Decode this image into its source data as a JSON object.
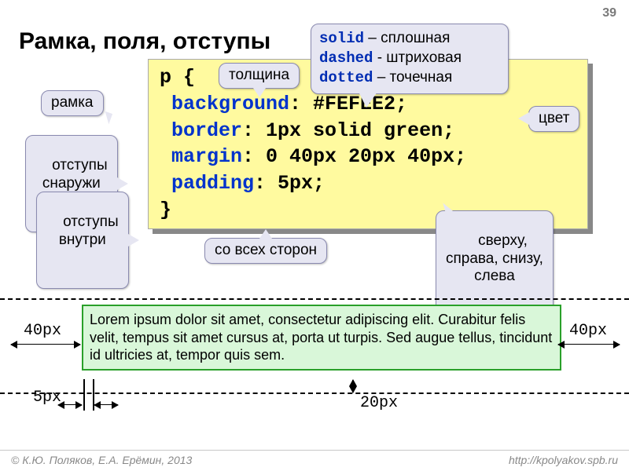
{
  "slide_number": "39",
  "title": "Рамка, поля, отступы",
  "code": {
    "line1a": "p {",
    "line2a": " background",
    "line2b": ": #FEFEE2;",
    "line3a": " border",
    "line3b": ": 1px solid green;",
    "line4a": " margin",
    "line4b": ": 0 40px 20px 40px;",
    "line5a": " padding",
    "line5b": ": 5px;",
    "line6": "}"
  },
  "callouts": {
    "ramka": "рамка",
    "outside": "отступы\nснаружи",
    "inside": "отступы\nвнутри",
    "thickness": "толщина",
    "color": "цвет",
    "allsides": "со всех сторон",
    "sides4": "сверху,\nсправа, снизу,\nслева"
  },
  "legend": {
    "solid_kw": "solid",
    "solid_txt": " – сплошная",
    "dashed_kw": "dashed",
    "dashed_txt": " - штриховая",
    "dotted_kw": "dotted",
    "dotted_txt": " – точечная"
  },
  "lorem": "Lorem ipsum dolor sit amet, consectetur adipiscing elit. Curabitur felis velit, tempus sit amet cursus at, porta ut turpis. Sed augue tellus, tincidunt id ultricies at, tempor quis sem.",
  "dims": {
    "m40l": "40px",
    "m40r": "40px",
    "p5": "5px",
    "m20": "20px"
  },
  "footer": {
    "left": "К.Ю. Поляков, Е.А. Ерёмин, 2013",
    "right": "http://kpolyakov.spb.ru"
  }
}
